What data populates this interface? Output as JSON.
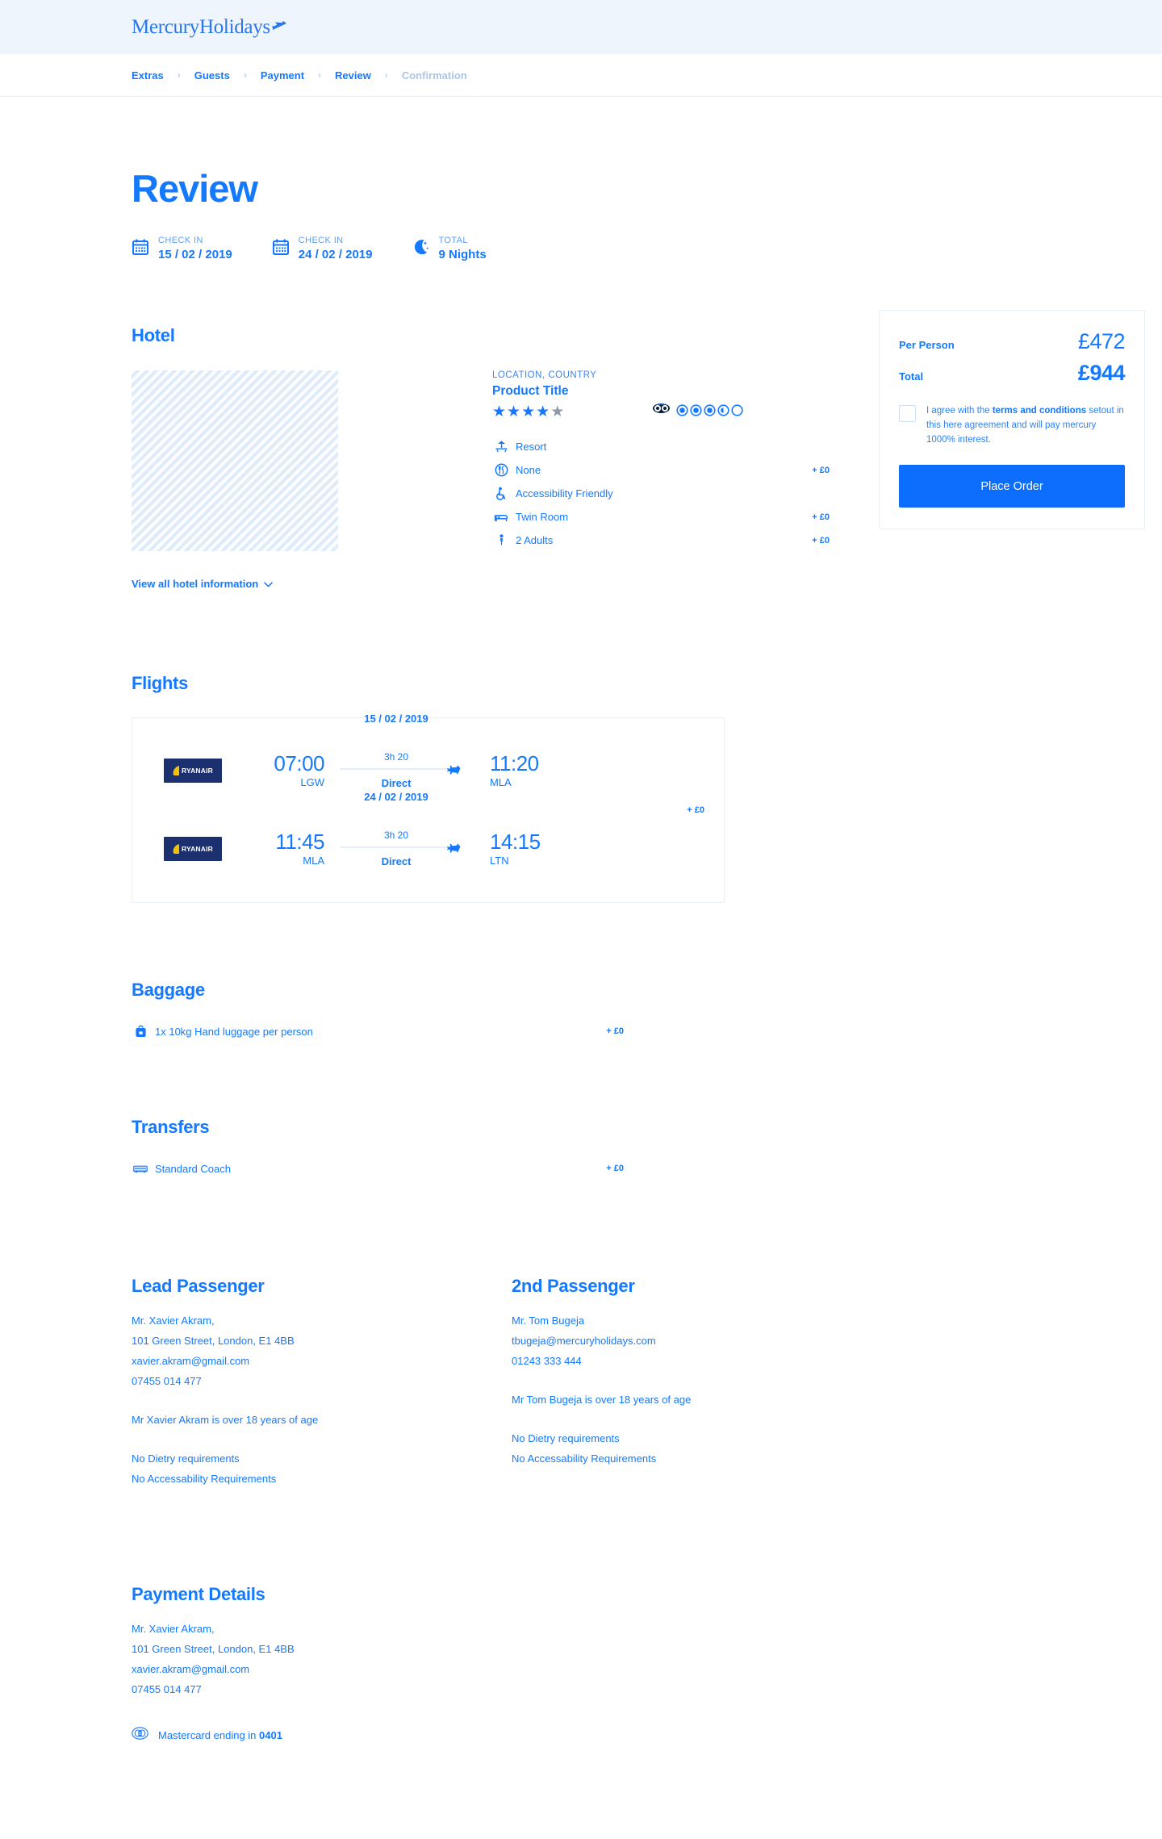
{
  "brand": {
    "logo_text": "MercuryHolidays",
    "logo_icon": "airplane-icon",
    "accent": "#1479ff",
    "header_bg": "#eef5fd"
  },
  "breadcrumb": {
    "items": [
      {
        "label": "Extras",
        "active": true
      },
      {
        "label": "Guests",
        "active": true
      },
      {
        "label": "Payment",
        "active": true
      },
      {
        "label": "Review",
        "active": true
      },
      {
        "label": "Confirmation",
        "active": false
      }
    ],
    "separator": "›"
  },
  "page": {
    "title": "Review"
  },
  "meta": [
    {
      "icon": "calendar-icon",
      "label": "CHECK IN",
      "value": "15 / 02 / 2019"
    },
    {
      "icon": "calendar-icon",
      "label": "CHECK IN",
      "value": "24 / 02 / 2019"
    },
    {
      "icon": "moon-icon",
      "label": "TOTAL",
      "value": "9 Nights"
    }
  ],
  "hotel": {
    "heading": "Hotel",
    "location": "LOCATION, COUNTRY",
    "product_title": "Product Title",
    "star_rating": 4,
    "star_total": 5,
    "tripadvisor": {
      "icon": "tripadvisor-owl-icon",
      "rating": 3.5,
      "total": 5
    },
    "features": [
      {
        "icon": "sun-lounger-icon",
        "label": "Resort",
        "price": ""
      },
      {
        "icon": "cutlery-icon",
        "label": "None",
        "price": "+ £0"
      },
      {
        "icon": "wheelchair-icon",
        "label": "Accessibility Friendly",
        "price": ""
      },
      {
        "icon": "bed-icon",
        "label": "Twin Room",
        "price": "+ £0"
      },
      {
        "icon": "person-icon",
        "label": "2 Adults",
        "price": "+ £0"
      }
    ],
    "view_all": "View all hotel information"
  },
  "flights": {
    "heading": "Flights",
    "price": "+ £0",
    "legs": [
      {
        "airline": "RYANAIR",
        "date": "15 / 02 / 2019",
        "depart_time": "07:00",
        "depart_code": "LGW",
        "duration": "3h 20",
        "stops": "Direct",
        "arrive_time": "11:20",
        "arrive_code": "MLA"
      },
      {
        "airline": "RYANAIR",
        "date": "24 / 02 / 2019",
        "depart_time": "11:45",
        "depart_code": "MLA",
        "duration": "3h 20",
        "stops": "Direct",
        "arrive_time": "14:15",
        "arrive_code": "LTN"
      }
    ]
  },
  "baggage": {
    "heading": "Baggage",
    "icon": "backpack-icon",
    "label": "1x 10kg Hand luggage per person",
    "price": "+ £0"
  },
  "transfers": {
    "heading": "Transfers",
    "icon": "coach-bus-icon",
    "label": "Standard Coach",
    "price": "+ £0"
  },
  "passengers": [
    {
      "heading": "Lead Passenger",
      "lines": [
        "Mr. Xavier Akram,",
        "101 Green Street, London, E1 4BB",
        "xavier.akram@gmail.com",
        "07455 014 477"
      ],
      "age_statement": "Mr Xavier Akram is over 18 years of age",
      "dietary": "No Dietry requirements",
      "accessibility": "No Accessability Requirements"
    },
    {
      "heading": "2nd Passenger",
      "lines": [
        "Mr. Tom Bugeja",
        "tbugeja@mercuryholidays.com",
        "01243 333 444"
      ],
      "age_statement": "Mr Tom Bugeja is over 18 years of age",
      "dietary": "No Dietry requirements",
      "accessibility": "No Accessability Requirements"
    }
  ],
  "payment": {
    "heading": "Payment Details",
    "lines": [
      "Mr. Xavier Akram,",
      "101 Green Street, London, E1 4BB",
      "xavier.akram@gmail.com",
      "07455 014 477"
    ],
    "card_icon": "credit-card-icon",
    "card_text_prefix": "Mastercard ending in ",
    "card_last4": "0401"
  },
  "summary": {
    "per_person_label": "Per Person",
    "per_person_value": "£472",
    "total_label": "Total",
    "total_value": "£944",
    "agree_pre": "I agree with the ",
    "agree_link": "terms and conditions",
    "agree_post": " setout in this here agreement and will pay mercury 1000% interest.",
    "checkbox_checked": false,
    "place_order_label": "Place Order",
    "button_color": "#0d6efd"
  }
}
